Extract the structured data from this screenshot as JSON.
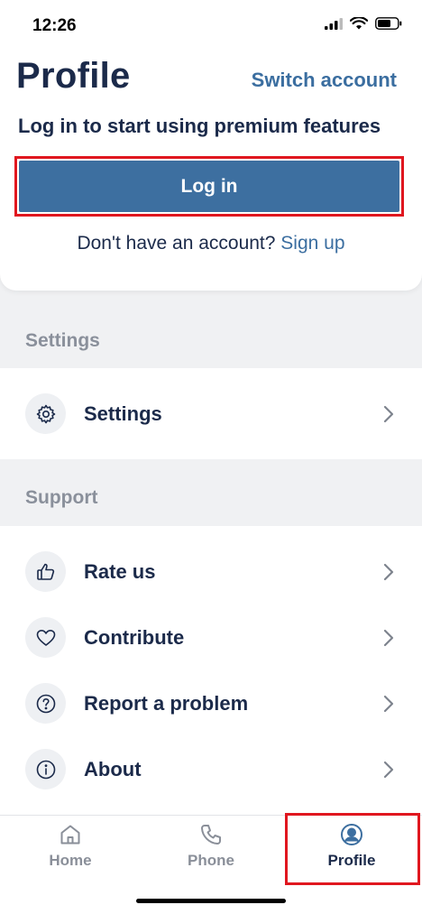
{
  "status_bar": {
    "time": "12:26"
  },
  "header": {
    "title": "Profile",
    "switch_account": "Switch account",
    "premium_text": "Log in to start using premium features",
    "login_button": "Log in",
    "signup_prompt": "Don't have an account?",
    "signup_link": "Sign up"
  },
  "sections": {
    "settings": {
      "label": "Settings",
      "items": [
        {
          "label": "Settings",
          "icon": "gear-icon"
        }
      ]
    },
    "support": {
      "label": "Support",
      "items": [
        {
          "label": "Rate us",
          "icon": "thumbs-up-icon"
        },
        {
          "label": "Contribute",
          "icon": "heart-icon"
        },
        {
          "label": "Report a problem",
          "icon": "question-icon"
        },
        {
          "label": "About",
          "icon": "info-icon"
        }
      ]
    }
  },
  "tab_bar": {
    "tabs": [
      {
        "label": "Home",
        "icon": "home-icon"
      },
      {
        "label": "Phone",
        "icon": "phone-icon"
      },
      {
        "label": "Profile",
        "icon": "profile-icon"
      }
    ],
    "active": "Profile"
  },
  "colors": {
    "accent": "#3d6fa0",
    "highlight_outline": "#e0171f",
    "title": "#1b2a4a",
    "section_label": "#8a909b"
  }
}
